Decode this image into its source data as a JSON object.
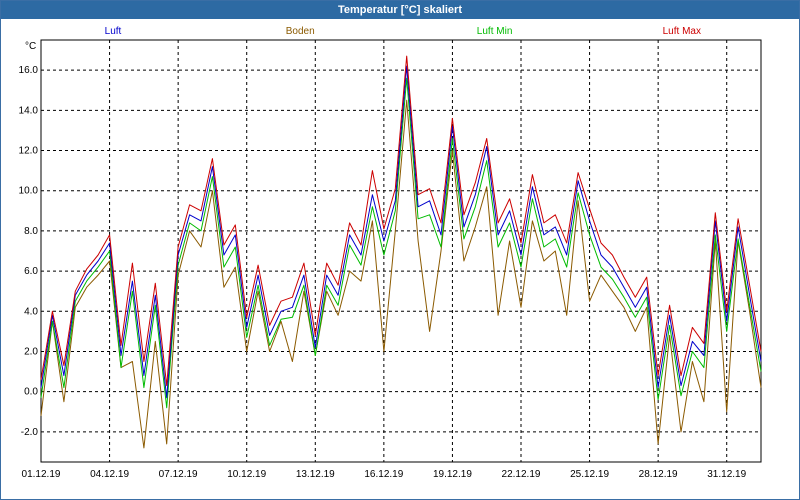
{
  "window": {
    "title": "Temperatur [°C] skaliert"
  },
  "colors": {
    "titlebar": "#2d6aa3",
    "luft": "#0000cc",
    "boden": "#8b5a00",
    "luft_min": "#00bb00",
    "luft_max": "#cc0000",
    "grid": "#000000"
  },
  "chart_data": {
    "type": "line",
    "title": "Temperatur [°C] skaliert",
    "ylabel": "°C",
    "xlabel": "",
    "ylim": [
      -3.5,
      17.5
    ],
    "xlim": [
      "2019-12-01",
      "2020-01-01 12:00"
    ],
    "grid": true,
    "legend_position": "top",
    "yticks": [
      "-2.0",
      "0.0",
      "2.0",
      "4.0",
      "6.0",
      "8.0",
      "10.0",
      "12.0",
      "14.0",
      "16.0"
    ],
    "ytick_values": [
      -2,
      0,
      2,
      4,
      6,
      8,
      10,
      12,
      14,
      16
    ],
    "xticks": [
      "01.12.19",
      "04.12.19",
      "07.12.19",
      "10.12.19",
      "13.12.19",
      "16.12.19",
      "19.12.19",
      "22.12.19",
      "25.12.19",
      "28.12.19",
      "31.12.19"
    ],
    "xtick_dates": [
      "2019-12-01",
      "2019-12-04",
      "2019-12-07",
      "2019-12-10",
      "2019-12-13",
      "2019-12-16",
      "2019-12-19",
      "2019-12-22",
      "2019-12-25",
      "2019-12-28",
      "2019-12-31"
    ],
    "series": [
      {
        "name": "Luft",
        "x": [
          "2019-12-01",
          "2019-12-01 12:00",
          "2019-12-02",
          "2019-12-02 12:00",
          "2019-12-03",
          "2019-12-03 12:00",
          "2019-12-04",
          "2019-12-04 12:00",
          "2019-12-05",
          "2019-12-05 12:00",
          "2019-12-06",
          "2019-12-06 12:00",
          "2019-12-07",
          "2019-12-07 12:00",
          "2019-12-08",
          "2019-12-08 12:00",
          "2019-12-09",
          "2019-12-09 12:00",
          "2019-12-10",
          "2019-12-10 12:00",
          "2019-12-11",
          "2019-12-11 12:00",
          "2019-12-12",
          "2019-12-12 12:00",
          "2019-12-13",
          "2019-12-13 12:00",
          "2019-12-14",
          "2019-12-14 12:00",
          "2019-12-15",
          "2019-12-15 12:00",
          "2019-12-16",
          "2019-12-16 12:00",
          "2019-12-17",
          "2019-12-17 12:00",
          "2019-12-18",
          "2019-12-18 12:00",
          "2019-12-19",
          "2019-12-19 12:00",
          "2019-12-20",
          "2019-12-20 12:00",
          "2019-12-21",
          "2019-12-21 12:00",
          "2019-12-22",
          "2019-12-22 12:00",
          "2019-12-23",
          "2019-12-23 12:00",
          "2019-12-24",
          "2019-12-24 12:00",
          "2019-12-25",
          "2019-12-25 12:00",
          "2019-12-26",
          "2019-12-26 12:00",
          "2019-12-27",
          "2019-12-27 12:00",
          "2019-12-28",
          "2019-12-28 12:00",
          "2019-12-29",
          "2019-12-29 12:00",
          "2019-12-30",
          "2019-12-30 12:00",
          "2019-12-31",
          "2019-12-31 12:00",
          "2020-01-01",
          "2020-01-01 12:00"
        ],
        "values": [
          0.2,
          3.8,
          0.8,
          4.8,
          5.8,
          6.5,
          7.4,
          1.8,
          5.5,
          0.8,
          4.8,
          -0.3,
          6.8,
          8.8,
          8.5,
          11.2,
          6.8,
          7.8,
          3.2,
          5.8,
          2.8,
          4.0,
          4.2,
          5.8,
          2.2,
          5.8,
          4.8,
          7.8,
          6.8,
          9.8,
          7.5,
          9.5,
          16.2,
          9.2,
          9.5,
          7.8,
          13.2,
          8.2,
          9.8,
          12.2,
          7.8,
          9.0,
          6.8,
          10.2,
          7.8,
          8.2,
          6.8,
          10.5,
          8.5,
          6.8,
          6.2,
          5.2,
          4.2,
          5.2,
          0.2,
          3.8,
          0.3,
          2.5,
          1.8,
          8.5,
          3.5,
          8.2,
          4.8,
          1.5
        ]
      },
      {
        "name": "Boden",
        "x": [
          "2019-12-01",
          "2019-12-01 12:00",
          "2019-12-02",
          "2019-12-02 12:00",
          "2019-12-03",
          "2019-12-03 12:00",
          "2019-12-04",
          "2019-12-04 12:00",
          "2019-12-05",
          "2019-12-05 12:00",
          "2019-12-06",
          "2019-12-06 12:00",
          "2019-12-07",
          "2019-12-07 12:00",
          "2019-12-08",
          "2019-12-08 12:00",
          "2019-12-09",
          "2019-12-09 12:00",
          "2019-12-10",
          "2019-12-10 12:00",
          "2019-12-11",
          "2019-12-11 12:00",
          "2019-12-12",
          "2019-12-12 12:00",
          "2019-12-13",
          "2019-12-13 12:00",
          "2019-12-14",
          "2019-12-14 12:00",
          "2019-12-15",
          "2019-12-15 12:00",
          "2019-12-16",
          "2019-12-16 12:00",
          "2019-12-17",
          "2019-12-17 12:00",
          "2019-12-18",
          "2019-12-18 12:00",
          "2019-12-19",
          "2019-12-19 12:00",
          "2019-12-20",
          "2019-12-20 12:00",
          "2019-12-21",
          "2019-12-21 12:00",
          "2019-12-22",
          "2019-12-22 12:00",
          "2019-12-23",
          "2019-12-23 12:00",
          "2019-12-24",
          "2019-12-24 12:00",
          "2019-12-25",
          "2019-12-25 12:00",
          "2019-12-26",
          "2019-12-26 12:00",
          "2019-12-27",
          "2019-12-27 12:00",
          "2019-12-28",
          "2019-12-28 12:00",
          "2019-12-29",
          "2019-12-29 12:00",
          "2019-12-30",
          "2019-12-30 12:00",
          "2019-12-31",
          "2019-12-31 12:00",
          "2020-01-01",
          "2020-01-01 12:00"
        ],
        "values": [
          -1.2,
          3.5,
          -0.5,
          4.2,
          5.2,
          5.8,
          6.5,
          1.2,
          1.5,
          -2.8,
          2.5,
          -2.6,
          5.8,
          8.0,
          7.2,
          10.0,
          5.2,
          6.2,
          2.0,
          5.0,
          2.0,
          3.5,
          1.5,
          5.0,
          1.8,
          5.0,
          3.8,
          6.0,
          5.5,
          8.5,
          2.0,
          8.0,
          14.5,
          7.5,
          3.0,
          7.0,
          12.0,
          6.5,
          8.2,
          10.2,
          3.8,
          7.5,
          4.2,
          8.5,
          6.5,
          7.0,
          3.8,
          9.5,
          4.5,
          5.8,
          5.0,
          4.2,
          3.0,
          4.2,
          -2.6,
          2.8,
          -2.0,
          1.5,
          -0.5,
          7.5,
          -1.0,
          7.5,
          4.0,
          0.2
        ]
      },
      {
        "name": "Luft Min",
        "x": [
          "2019-12-01",
          "2019-12-01 12:00",
          "2019-12-02",
          "2019-12-02 12:00",
          "2019-12-03",
          "2019-12-03 12:00",
          "2019-12-04",
          "2019-12-04 12:00",
          "2019-12-05",
          "2019-12-05 12:00",
          "2019-12-06",
          "2019-12-06 12:00",
          "2019-12-07",
          "2019-12-07 12:00",
          "2019-12-08",
          "2019-12-08 12:00",
          "2019-12-09",
          "2019-12-09 12:00",
          "2019-12-10",
          "2019-12-10 12:00",
          "2019-12-11",
          "2019-12-11 12:00",
          "2019-12-12",
          "2019-12-12 12:00",
          "2019-12-13",
          "2019-12-13 12:00",
          "2019-12-14",
          "2019-12-14 12:00",
          "2019-12-15",
          "2019-12-15 12:00",
          "2019-12-16",
          "2019-12-16 12:00",
          "2019-12-17",
          "2019-12-17 12:00",
          "2019-12-18",
          "2019-12-18 12:00",
          "2019-12-19",
          "2019-12-19 12:00",
          "2019-12-20",
          "2019-12-20 12:00",
          "2019-12-21",
          "2019-12-21 12:00",
          "2019-12-22",
          "2019-12-22 12:00",
          "2019-12-23",
          "2019-12-23 12:00",
          "2019-12-24",
          "2019-12-24 12:00",
          "2019-12-25",
          "2019-12-25 12:00",
          "2019-12-26",
          "2019-12-26 12:00",
          "2019-12-27",
          "2019-12-27 12:00",
          "2019-12-28",
          "2019-12-28 12:00",
          "2019-12-29",
          "2019-12-29 12:00",
          "2019-12-30",
          "2019-12-30 12:00",
          "2019-12-31",
          "2019-12-31 12:00",
          "2020-01-01",
          "2020-01-01 12:00"
        ],
        "values": [
          -0.3,
          3.5,
          0.2,
          4.5,
          5.5,
          6.2,
          7.0,
          1.2,
          5.0,
          0.2,
          4.3,
          -0.8,
          6.3,
          8.4,
          8.0,
          10.7,
          6.2,
          7.2,
          2.7,
          5.3,
          2.3,
          3.6,
          3.7,
          5.3,
          1.8,
          5.3,
          4.3,
          7.3,
          6.3,
          9.2,
          6.8,
          9.0,
          15.6,
          8.6,
          8.8,
          7.2,
          12.6,
          7.6,
          9.2,
          11.5,
          7.2,
          8.4,
          6.2,
          9.6,
          7.2,
          7.6,
          6.2,
          9.9,
          7.8,
          6.2,
          5.6,
          4.7,
          3.7,
          4.7,
          -0.4,
          3.3,
          -0.2,
          2.0,
          1.2,
          7.8,
          3.0,
          7.6,
          4.3,
          1.0
        ]
      },
      {
        "name": "Luft Max",
        "x": [
          "2019-12-01",
          "2019-12-01 12:00",
          "2019-12-02",
          "2019-12-02 12:00",
          "2019-12-03",
          "2019-12-03 12:00",
          "2019-12-04",
          "2019-12-04 12:00",
          "2019-12-05",
          "2019-12-05 12:00",
          "2019-12-06",
          "2019-12-06 12:00",
          "2019-12-07",
          "2019-12-07 12:00",
          "2019-12-08",
          "2019-12-08 12:00",
          "2019-12-09",
          "2019-12-09 12:00",
          "2019-12-10",
          "2019-12-10 12:00",
          "2019-12-11",
          "2019-12-11 12:00",
          "2019-12-12",
          "2019-12-12 12:00",
          "2019-12-13",
          "2019-12-13 12:00",
          "2019-12-14",
          "2019-12-14 12:00",
          "2019-12-15",
          "2019-12-15 12:00",
          "2019-12-16",
          "2019-12-16 12:00",
          "2019-12-17",
          "2019-12-17 12:00",
          "2019-12-18",
          "2019-12-18 12:00",
          "2019-12-19",
          "2019-12-19 12:00",
          "2019-12-20",
          "2019-12-20 12:00",
          "2019-12-21",
          "2019-12-21 12:00",
          "2019-12-22",
          "2019-12-22 12:00",
          "2019-12-23",
          "2019-12-23 12:00",
          "2019-12-24",
          "2019-12-24 12:00",
          "2019-12-25",
          "2019-12-25 12:00",
          "2019-12-26",
          "2019-12-26 12:00",
          "2019-12-27",
          "2019-12-27 12:00",
          "2019-12-28",
          "2019-12-28 12:00",
          "2019-12-29",
          "2019-12-29 12:00",
          "2019-12-30",
          "2019-12-30 12:00",
          "2019-12-31",
          "2019-12-31 12:00",
          "2020-01-01",
          "2020-01-01 12:00"
        ],
        "values": [
          0.6,
          4.0,
          1.3,
          5.0,
          6.1,
          6.8,
          7.8,
          2.3,
          6.4,
          1.5,
          5.4,
          0.3,
          7.2,
          9.3,
          9.0,
          11.6,
          7.3,
          8.3,
          3.7,
          6.3,
          3.3,
          4.5,
          4.7,
          6.4,
          2.8,
          6.4,
          5.3,
          8.4,
          7.3,
          11.0,
          8.1,
          10.1,
          16.7,
          9.8,
          10.1,
          8.4,
          13.6,
          8.8,
          10.4,
          12.6,
          8.4,
          9.6,
          7.4,
          10.8,
          8.4,
          8.8,
          7.4,
          10.9,
          9.1,
          7.4,
          6.8,
          5.7,
          4.7,
          5.7,
          0.8,
          4.3,
          0.8,
          3.2,
          2.4,
          8.9,
          4.0,
          8.6,
          5.3,
          2.0
        ]
      }
    ]
  }
}
